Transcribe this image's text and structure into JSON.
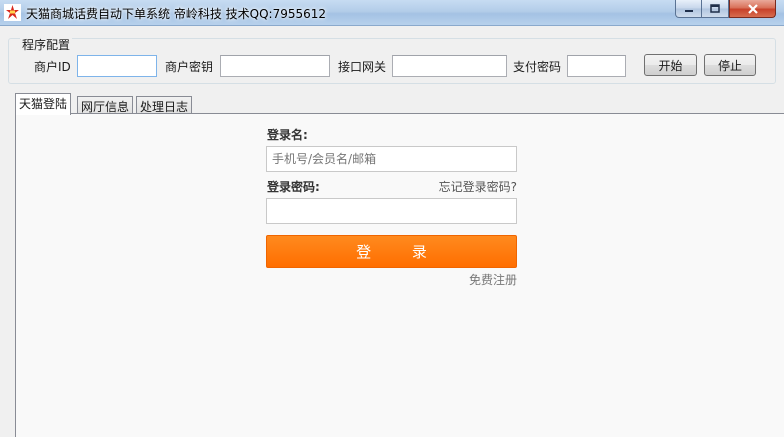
{
  "window": {
    "title": "天猫商城话费自动下单系统 帝岭科技 技术QQ:7955612"
  },
  "config": {
    "group_title": "程序配置",
    "merchant_id_label": "商户ID",
    "merchant_id_value": "",
    "merchant_key_label": "商户密钥",
    "merchant_key_value": "",
    "gateway_label": "接口网关",
    "gateway_value": "",
    "pay_password_label": "支付密码",
    "pay_password_value": "",
    "start_button": "开始",
    "stop_button": "停止"
  },
  "tabs": [
    {
      "label": "天猫登陆",
      "active": true
    },
    {
      "label": "网厅信息",
      "active": false
    },
    {
      "label": "处理日志",
      "active": false
    }
  ],
  "login": {
    "username_label": "登录名:",
    "username_placeholder": "手机号/会员名/邮箱",
    "password_label": "登录密码:",
    "forgot_link": "忘记登录密码?",
    "submit_label": "登 录",
    "register_link": "免费注册"
  },
  "colors": {
    "accent": "#ff7300",
    "titlebar": "#b3cde9",
    "panel_bg": "#f9f9f9"
  },
  "icons": {
    "app": "app-logo-icon",
    "minimize": "minimize-icon",
    "maximize": "maximize-icon",
    "close": "close-icon"
  }
}
